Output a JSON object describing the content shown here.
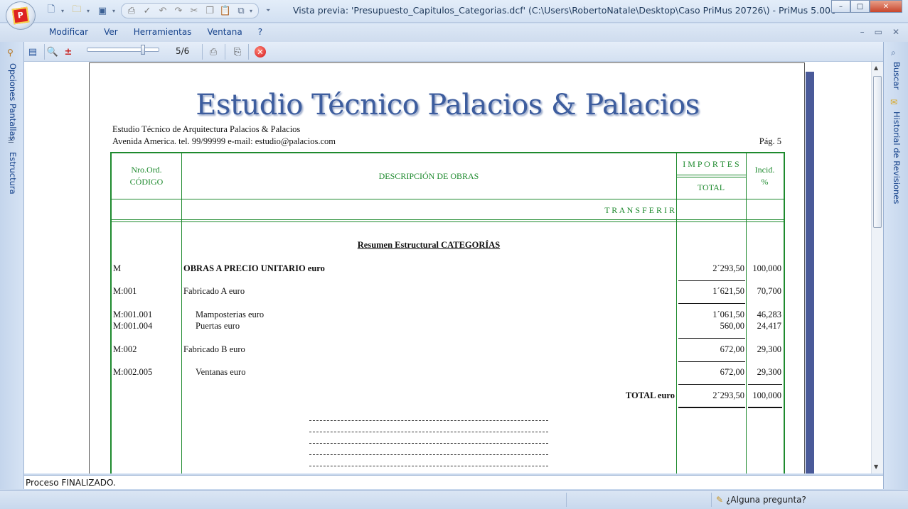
{
  "window": {
    "title": "Vista previa: 'Presupuesto_Capitulos_Categorias.dcf'   (C:\\Users\\RobertoNatale\\Desktop\\Caso PriMus 20726\\) - PriMus    5.00c",
    "controls": {
      "minimize": "–",
      "maximize": "□",
      "close": "✕"
    }
  },
  "menu": {
    "items": [
      "Modificar",
      "Ver",
      "Herramientas",
      "Ventana",
      "?"
    ],
    "mdi_controls": {
      "minimize": "–",
      "restore": "▭",
      "close": "✕"
    }
  },
  "toolbar": {
    "page_indicator": "5/6",
    "zoom_level": 0.78
  },
  "left_panel": {
    "tabs": [
      "Opciones Pantallas",
      "Estructura"
    ]
  },
  "right_panel": {
    "tabs": [
      "Buscar",
      "Historial de Revisiones"
    ]
  },
  "document": {
    "company_title": "Estudio Técnico Palacios & Palacios",
    "header_line1": "Estudio Técnico de Arquitectura Palacios & Palacios",
    "header_line2": "Avenida America.  tel. 99/99999 e-mail: estudio@palacios.com",
    "page_label": "Pág. 5",
    "table_headers": {
      "nro_ord": "Nro.Ord.",
      "codigo": "CÓDIGO",
      "descripcion": "DESCRIPCIÓN DE OBRAS",
      "importes": "I M P O R T E S",
      "total": "TOTAL",
      "incid": "Incid.",
      "percent": "%",
      "transferir": "T R A N S F E R I R"
    },
    "section_title": "Resumen Estructural  CATEGORÍAS",
    "rows": [
      {
        "code": "M",
        "description": "OBRAS A PRECIO UNITARIO euro",
        "total": "2´293,50",
        "incid": "100,000"
      },
      {
        "code": "M:001",
        "description": "Fabricado A euro",
        "total": "1´621,50",
        "incid": "70,700"
      },
      {
        "code": "M:001.001",
        "description": "Mamposterias euro",
        "total": "1´061,50",
        "incid": "46,283"
      },
      {
        "code": "M:001.004",
        "description": "Puertas euro",
        "total": "560,00",
        "incid": "24,417"
      },
      {
        "code": "M:002",
        "description": "Fabricado B euro",
        "total": "672,00",
        "incid": "29,300"
      },
      {
        "code": "M:002.005",
        "description": "Ventanas euro",
        "total": "672,00",
        "incid": "29,300"
      }
    ],
    "grand_total": {
      "label": "TOTAL  euro",
      "total": "2´293,50",
      "incid": "100,000"
    }
  },
  "status": {
    "message": "Proceso FINALIZADO.",
    "help": "¿Alguna pregunta?"
  },
  "colors": {
    "table_green": "#1e8a2e",
    "title_blue": "#3d5d9e",
    "menu_text": "#15428b"
  }
}
